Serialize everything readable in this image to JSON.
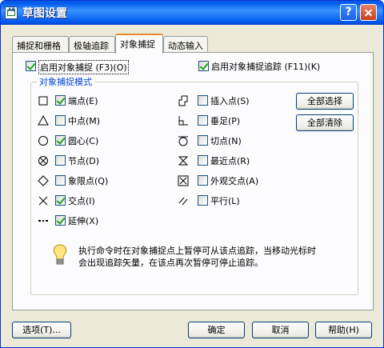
{
  "window": {
    "title": "草图设置",
    "help_btn": "?"
  },
  "tabs": [
    {
      "label": "捕捉和栅格"
    },
    {
      "label": "极轴追踪"
    },
    {
      "label": "对象捕捉"
    },
    {
      "label": "动态输入"
    }
  ],
  "osnap_on": {
    "label": "启用对象捕捉 (F3)(O)",
    "checked": true
  },
  "osnap_track": {
    "label": "启用对象捕捉追踪 (F11)(K)",
    "checked": true
  },
  "group_title": "对象捕捉模式",
  "left_modes": [
    {
      "label": "端点(E)",
      "checked": true,
      "icon": "endpoint-icon"
    },
    {
      "label": "中点(M)",
      "checked": false,
      "icon": "midpoint-icon"
    },
    {
      "label": "圆心(C)",
      "checked": true,
      "icon": "center-icon"
    },
    {
      "label": "节点(D)",
      "checked": false,
      "icon": "node-icon"
    },
    {
      "label": "象限点(Q)",
      "checked": false,
      "icon": "quadrant-icon"
    },
    {
      "label": "交点(I)",
      "checked": true,
      "icon": "intersection-icon"
    },
    {
      "label": "延伸(X)",
      "checked": true,
      "icon": "extension-icon"
    }
  ],
  "right_modes": [
    {
      "label": "插入点(S)",
      "checked": false,
      "icon": "insertion-icon"
    },
    {
      "label": "垂足(P)",
      "checked": false,
      "icon": "perpendicular-icon"
    },
    {
      "label": "切点(N)",
      "checked": false,
      "icon": "tangent-icon"
    },
    {
      "label": "最近点(R)",
      "checked": false,
      "icon": "nearest-icon"
    },
    {
      "label": "外观交点(A)",
      "checked": false,
      "icon": "apparent-intersection-icon"
    },
    {
      "label": "平行(L)",
      "checked": false,
      "icon": "parallel-icon"
    }
  ],
  "select_all": "全部选择",
  "clear_all": "全部清除",
  "hint_line1": "执行命令时在对象捕捉点上暂停可从该点追踪，当移动光标时",
  "hint_line2": "会出现追踪矢量，在该点再次暂停可停止追踪。",
  "footer": {
    "options": "选项(T)...",
    "ok": "确定",
    "cancel": "取消",
    "help": "帮助(H)"
  }
}
